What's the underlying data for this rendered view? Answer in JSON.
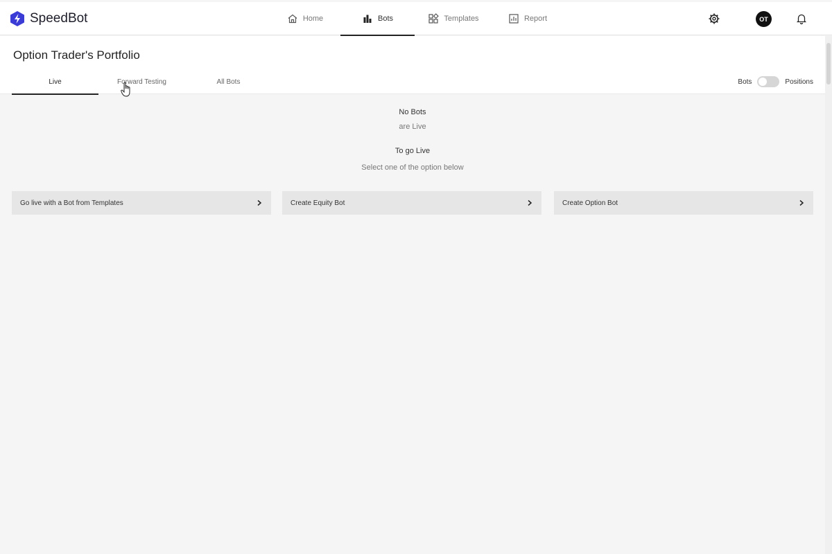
{
  "app": {
    "name": "SpeedBot",
    "brand_color": "#3b3bd6"
  },
  "nav": {
    "items": [
      {
        "label": "Home",
        "icon": "home-icon"
      },
      {
        "label": "Bots",
        "icon": "bar-chart-icon",
        "active": true
      },
      {
        "label": "Templates",
        "icon": "templates-grid-icon"
      },
      {
        "label": "Report",
        "icon": "report-icon"
      }
    ]
  },
  "user": {
    "initials": "OT"
  },
  "page": {
    "title": "Option Trader's Portfolio"
  },
  "tabs": [
    {
      "label": "Live",
      "active": true
    },
    {
      "label": "Forward Testing"
    },
    {
      "label": "All Bots"
    }
  ],
  "toggle": {
    "left_label": "Bots",
    "right_label": "Positions"
  },
  "empty_state": {
    "line1": "No Bots",
    "line2": "are Live",
    "line3": "To go Live",
    "line4": "Select one of the option below"
  },
  "options": [
    {
      "label": "Go live with a Bot from Templates"
    },
    {
      "label": "Create Equity Bot"
    },
    {
      "label": "Create Option Bot"
    }
  ]
}
